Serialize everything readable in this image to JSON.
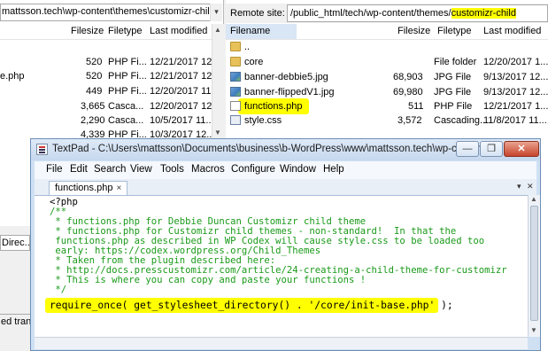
{
  "local": {
    "path": "mattsson.tech\\wp-content\\themes\\customizr-child\\",
    "columns": {
      "filesize": "Filesize",
      "filetype": "Filetype",
      "last_modified": "Last modified"
    },
    "rows": [
      {
        "name": "",
        "size": "520",
        "type": "PHP Fi...",
        "modified": "12/21/2017 12..."
      },
      {
        "name": "e.php",
        "size": "520",
        "type": "PHP Fi...",
        "modified": "12/21/2017 12..."
      },
      {
        "name": "",
        "size": "449",
        "type": "PHP Fi...",
        "modified": "12/20/2017 11..."
      },
      {
        "name": "",
        "size": "3,665",
        "type": "Casca...",
        "modified": "12/20/2017 12..."
      },
      {
        "name": "",
        "size": "2,290",
        "type": "Casca...",
        "modified": "10/5/2017 11..."
      },
      {
        "name": "",
        "size": "4,339",
        "type": "PHP Fi...",
        "modified": "10/3/2017 12..."
      }
    ],
    "bottom_tab": "Direc...",
    "queued_tab": "ed tran"
  },
  "remote": {
    "label": "Remote site:",
    "path_prefix": "/public_html/tech/wp-content/themes/",
    "path_highlight": "customizr-child",
    "columns": {
      "filename": "Filename",
      "filesize": "Filesize",
      "filetype": "Filetype",
      "last_modified": "Last modified"
    },
    "rows": [
      {
        "icon": "folder-icon",
        "name": "..",
        "size": "",
        "type": "",
        "modified": ""
      },
      {
        "icon": "folder-icon",
        "name": "core",
        "size": "",
        "type": "File folder",
        "modified": "12/20/2017 1..."
      },
      {
        "icon": "image-file-icon",
        "name": "banner-debbie5.jpg",
        "size": "68,903",
        "type": "JPG File",
        "modified": "9/13/2017 12..."
      },
      {
        "icon": "image-file-icon",
        "name": "banner-flippedV1.jpg",
        "size": "69,980",
        "type": "JPG File",
        "modified": "9/13/2017 12..."
      },
      {
        "icon": "php-file-icon",
        "name": "functions.php",
        "size": "511",
        "type": "PHP File",
        "modified": "12/21/2017 1..."
      },
      {
        "icon": "css-file-icon",
        "name": "style.css",
        "size": "3,572",
        "type": "Cascading...",
        "modified": "11/8/2017 11..."
      }
    ]
  },
  "textpad": {
    "title": "TextPad - C:\\Users\\mattsson\\Documents\\business\\b-WordPress\\www\\mattsson.tech\\wp-conten...",
    "menu": [
      "File",
      "Edit",
      "Search",
      "View",
      "Tools",
      "Macros",
      "Configure",
      "Window",
      "Help"
    ],
    "tab_label": "functions.php",
    "tab_close": "×",
    "code": [
      "<?php",
      "/**",
      " * functions.php for Debbie Duncan Customizr child theme",
      " * functions.php for Customizr child themes - non-standard!  In that the",
      " functions.php as described in WP Codex will cause style.css to be loaded too",
      " early: https://codex.wordpress.org/Child_Themes",
      " * Taken from the plugin described here:",
      " * http://docs.presscustomizr.com/article/24-creating-a-child-theme-for-customizr",
      " * This is where you can copy and paste your functions !",
      " */"
    ],
    "code_highlight": "require_once( get_stylesheet_directory() . '/core/init-base.php' );",
    "colors": {
      "comment": "#1a9a1a",
      "highlight": "#ffff00",
      "title_bar": "#c6d8ee"
    }
  }
}
